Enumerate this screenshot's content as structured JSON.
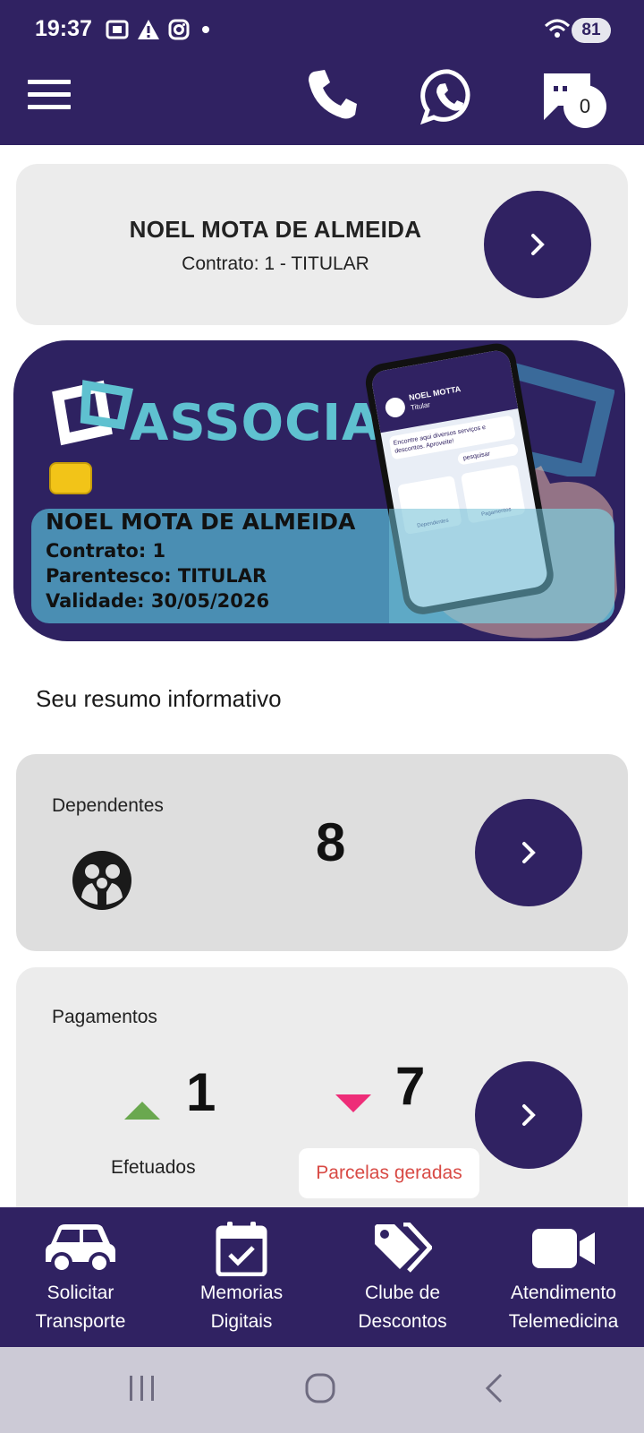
{
  "status_bar": {
    "time": "19:37",
    "battery": "81",
    "icons_left": [
      "screenshot-icon",
      "warning-icon",
      "instagram-icon",
      "dot-icon"
    ],
    "icons_right": [
      "wifi-icon",
      "signal-icon"
    ]
  },
  "header": {
    "chat_count": "0",
    "icons": [
      "menu-icon",
      "phone-icon",
      "whatsapp-icon",
      "chat-icon"
    ]
  },
  "user": {
    "name": "NOEL MOTA DE ALMEIDA",
    "contract_line": "Contrato: 1  -  TITULAR"
  },
  "member_card": {
    "brand": "ASSOCIADO",
    "name": "NOEL MOTA DE ALMEIDA",
    "contract": "Contrato: 1",
    "kinship": "Parentesco: TITULAR",
    "validity": "Validade: 30/05/2026",
    "phone_mockup": {
      "user_name": "NOEL MOTTA",
      "user_role": "Titular",
      "promo_text": "Encontre aqui diversos serviços e descontos. Aproveite!",
      "search_label": "pesquisar",
      "tiles": [
        "Dependentes",
        "Pagamentos"
      ]
    }
  },
  "summary": {
    "title": "Seu resumo informativo",
    "dependents": {
      "label": "Dependentes",
      "count": "8"
    },
    "payments": {
      "label": "Pagamentos",
      "paid_count": "1",
      "paid_label": "Efetuados",
      "generated_count": "7",
      "generated_label": "Parcelas geradas"
    }
  },
  "bottom_nav": [
    {
      "icon": "car-icon",
      "line1": "Solicitar",
      "line2": "Transporte"
    },
    {
      "icon": "calendar-check-icon",
      "line1": "Memorias",
      "line2": "Digitais"
    },
    {
      "icon": "tags-icon",
      "line1": "Clube de",
      "line2": "Descontos"
    },
    {
      "icon": "video-camera-icon",
      "line1": "Atendimento",
      "line2": "Telemedicina"
    }
  ],
  "colors": {
    "primary": "#302262",
    "accent_cyan": "#5fc1d0",
    "up_green": "#6aa84f",
    "down_pink": "#ee2d78",
    "alert_red": "#d84a45"
  }
}
